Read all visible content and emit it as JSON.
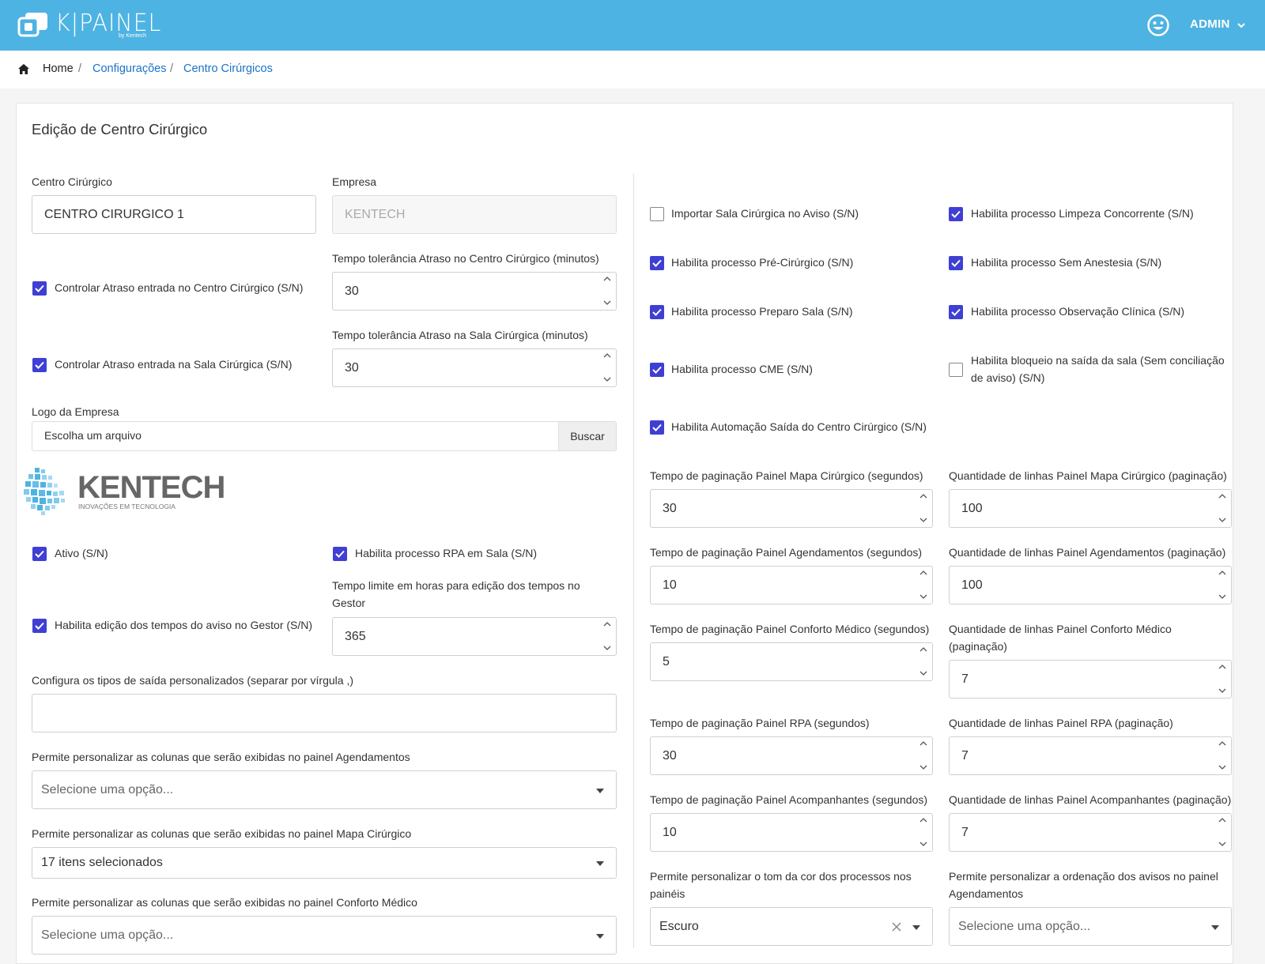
{
  "header": {
    "logo_text": "K|PAINEL",
    "logo_sub": "by Kentech",
    "user_name": "ADMIN"
  },
  "breadcrumb": {
    "home": "Home",
    "items": [
      "Configurações",
      "Centro Cirúrgicos"
    ]
  },
  "card_title": "Edição de Centro Cirúrgico",
  "left": {
    "centro_label": "Centro Cirúrgico",
    "centro_value": "CENTRO CIRURGICO 1",
    "empresa_label": "Empresa",
    "empresa_value": "KENTECH",
    "controlar_cc": "Controlar Atraso entrada no Centro Cirúrgico (S/N)",
    "tol_cc_label": "Tempo tolerância Atraso no Centro Cirúrgico (minutos)",
    "tol_cc_value": "30",
    "controlar_sala": "Controlar Atraso entrada na Sala Cirúrgica (S/N)",
    "tol_sala_label": "Tempo tolerância Atraso na Sala Cirúrgica (minutos)",
    "tol_sala_value": "30",
    "logo_label": "Logo da Empresa",
    "logo_placeholder": "Escolha um arquivo",
    "logo_button": "Buscar",
    "kentech_name": "KENTECH",
    "kentech_tagline": "INOVAÇÕES EM TECNOLOGIA",
    "ativo": "Ativo (S/N)",
    "rpa_sala": "Habilita processo RPA em Sala (S/N)",
    "limite_label": "Tempo limite em horas para edição dos tempos no Gestor",
    "limite_value": "365",
    "edicao_gestor": "Habilita edição dos tempos do aviso no Gestor (S/N)",
    "tipos_saida_label": "Configura os tipos de saída personalizados (separar por vírgula ,)",
    "tipos_saida_value": "",
    "col_agend_label": "Permite personalizar as colunas que serão exibidas no painel Agendamentos",
    "col_agend_value": "Selecione uma opção...",
    "col_mapa_label": "Permite personalizar as colunas que serão exibidas no painel Mapa Cirúrgico",
    "col_mapa_value": "17 itens selecionados",
    "col_conforto_label": "Permite personalizar as colunas que serão exibidas no painel Conforto Médico",
    "col_conforto_value": "Selecione uma opção..."
  },
  "right": {
    "checks": {
      "importar_sala": "Importar Sala Cirúrgica no Aviso (S/N)",
      "limpeza": "Habilita processo Limpeza Concorrente (S/N)",
      "pre_cirurgico": "Habilita processo Pré-Cirúrgico (S/N)",
      "sem_anestesia": "Habilita processo Sem Anestesia (S/N)",
      "preparo_sala": "Habilita processo Preparo Sala (S/N)",
      "observacao": "Habilita processo Observação Clínica (S/N)",
      "cme": "Habilita processo CME (S/N)",
      "bloqueio_l1": "Habilita bloqueio na saída da sala (Sem conciliação",
      "bloqueio_l2": "de aviso) (S/N)",
      "automacao": "Habilita Automação Saída do Centro Cirúrgico (S/N)"
    },
    "fields": {
      "pag_mapa_label": "Tempo de paginação Painel Mapa Cirúrgico (segundos)",
      "pag_mapa_value": "30",
      "lin_mapa_label": "Quantidade de linhas Painel Mapa Cirúrgico (paginação)",
      "lin_mapa_value": "100",
      "pag_agend_label": "Tempo de paginação Painel Agendamentos (segundos)",
      "pag_agend_value": "10",
      "lin_agend_label": "Quantidade de linhas Painel Agendamentos (paginação)",
      "lin_agend_value": "100",
      "pag_conforto_label": "Tempo de paginação Painel Conforto Médico (segundos)",
      "pag_conforto_value": "5",
      "lin_conforto_label_l1": "Quantidade de linhas Painel Conforto Médico",
      "lin_conforto_label_l2": "(paginação)",
      "lin_conforto_value": "7",
      "pag_rpa_label": "Tempo de paginação Painel RPA (segundos)",
      "pag_rpa_value": "30",
      "lin_rpa_label": "Quantidade de linhas Painel RPA (paginação)",
      "lin_rpa_value": "7",
      "pag_acomp_label": "Tempo de paginação Painel Acompanhantes (segundos)",
      "pag_acomp_value": "10",
      "lin_acomp_label": "Quantidade de linhas Painel Acompanhantes (paginação)",
      "lin_acomp_value": "7",
      "tom_label_l1": "Permite personalizar o tom da cor dos processos nos",
      "tom_label_l2": "painéis",
      "tom_value": "Escuro",
      "ordenacao_label_l1": "Permite personalizar a ordenação dos avisos no painel",
      "ordenacao_label_l2": "Agendamentos",
      "ordenacao_value": "Selecione uma opção..."
    }
  },
  "colors": {
    "header_bg": "#4db3e2",
    "link": "#1a73c8",
    "checkbox": "#3f3fd4"
  }
}
